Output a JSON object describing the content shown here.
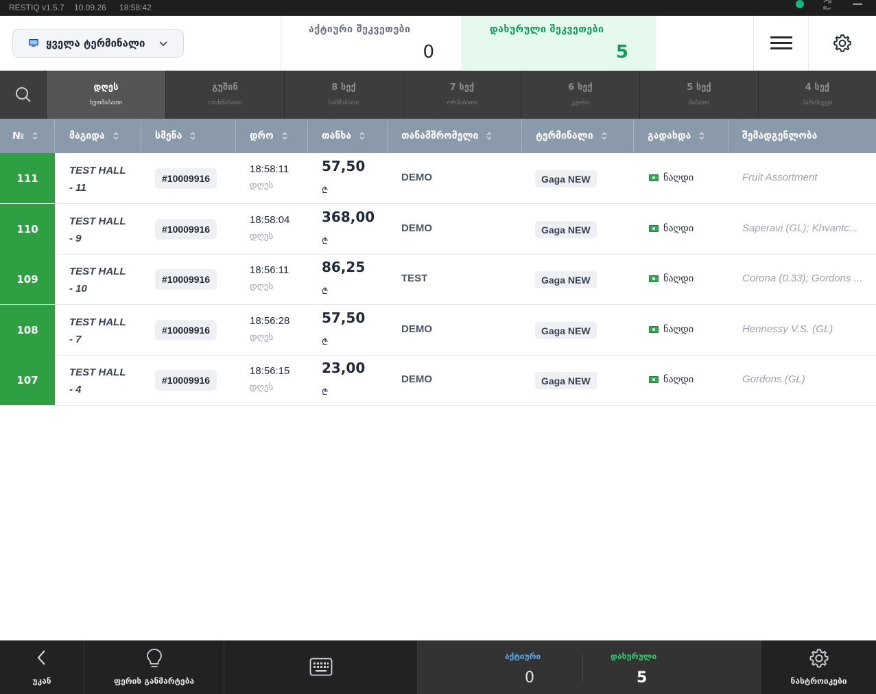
{
  "titlebar": {
    "app": "RESTIQ v1.5.7",
    "date": "10.09.26",
    "time": "18:58:42",
    "status_color": "#10b981"
  },
  "header": {
    "terminal_select": "ყველა ტერმინალი",
    "active_label": "აქტიური შეკვეთები",
    "active_value": "0",
    "closed_label": "დახურული შეკვეთები",
    "closed_value": "5"
  },
  "days": [
    {
      "top": "დღეს",
      "sub": "ხუთშაბათი",
      "active": true
    },
    {
      "top": "გუშინ",
      "sub": "ოთხშაბათი"
    },
    {
      "top": "8 სექ",
      "sub": "სამშაბათი"
    },
    {
      "top": "7 სექ",
      "sub": "ორშაბათი"
    },
    {
      "top": "6 სექ",
      "sub": "კვირა"
    },
    {
      "top": "5 სექ",
      "sub": "შაბათი"
    },
    {
      "top": "4 სექ",
      "sub": "პარასკევი"
    }
  ],
  "columns": [
    "№",
    "მაგიდა",
    "სმენა",
    "დრო",
    "თანხა",
    "თანამშრომელი",
    "ტერმინალი",
    "გადახდა",
    "შემადგენლობა"
  ],
  "rows": [
    {
      "num": "111",
      "table": "TEST HALL - 11",
      "shift": "#10009916",
      "time": "18:58:11",
      "day": "დღეს",
      "amount": "57,50",
      "currency": "₾",
      "employee": "DEMO",
      "terminal": "Gaga NEW",
      "payment": "ნაღდი",
      "composition": "Fruit Assortment"
    },
    {
      "num": "110",
      "table": "TEST HALL - 9",
      "shift": "#10009916",
      "time": "18:58:04",
      "day": "დღეს",
      "amount": "368,00",
      "currency": "₾",
      "employee": "DEMO",
      "terminal": "Gaga NEW",
      "payment": "ნაღდი",
      "composition": "Saperavi (GL); Khvantc..."
    },
    {
      "num": "109",
      "table": "TEST HALL - 10",
      "shift": "#10009916",
      "time": "18:56:11",
      "day": "დღეს",
      "amount": "86,25",
      "currency": "₾",
      "employee": "TEST",
      "terminal": "Gaga NEW",
      "payment": "ნაღდი",
      "composition": "Corona (0.33); Gordons ..."
    },
    {
      "num": "108",
      "table": "TEST HALL - 7",
      "shift": "#10009916",
      "time": "18:56:28",
      "day": "დღეს",
      "amount": "57,50",
      "currency": "₾",
      "employee": "DEMO",
      "terminal": "Gaga NEW",
      "payment": "ნაღდი",
      "composition": "Hennessy V.S. (GL)"
    },
    {
      "num": "107",
      "table": "TEST HALL - 4",
      "shift": "#10009916",
      "time": "18:56:15",
      "day": "დღეს",
      "amount": "23,00",
      "currency": "₾",
      "employee": "DEMO",
      "terminal": "Gaga NEW",
      "payment": "ნაღდი",
      "composition": "Gordons (GL)"
    }
  ],
  "footer": {
    "back": "უკან",
    "colors": "ფერის განმარტება",
    "active_label": "აქტიური",
    "active_value": "0",
    "closed_label": "დახურული",
    "closed_value": "5",
    "settings": "ნასტროიკები"
  },
  "colors": {
    "accent_green": "#2ea043",
    "closed_green": "#0f9d58",
    "table_header": "#8a9aab",
    "active_blue": "#5aa9e6"
  }
}
